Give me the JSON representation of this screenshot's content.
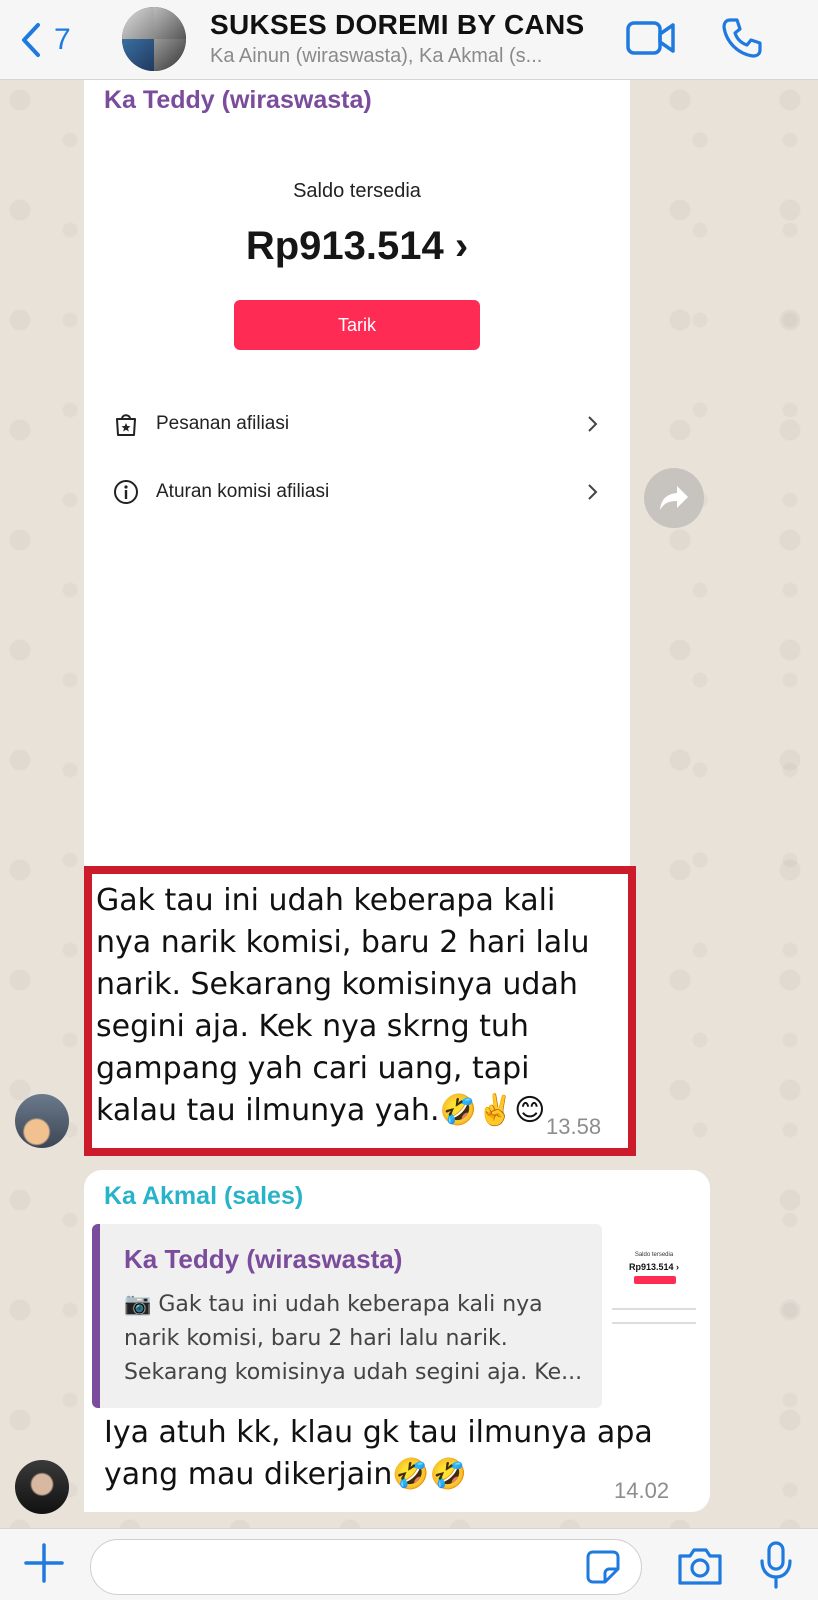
{
  "header": {
    "back_count": "7",
    "title": "SUKSES DOREMI BY CANS",
    "subtitle": "Ka Ainun (wiraswasta), Ka Akmal (s..."
  },
  "messages": {
    "image_msg": {
      "sender": "Ka Teddy (wiraswasta)",
      "screenshot": {
        "saldo_label": "Saldo tersedia",
        "saldo_amount": "Rp913.514 ›",
        "tarik_label": "Tarik",
        "menu": [
          {
            "label": "Pesanan afiliasi",
            "icon": "shopping-bag-icon"
          },
          {
            "label": "Aturan komisi afiliasi",
            "icon": "info-icon"
          }
        ]
      },
      "caption": "Gak tau ini udah keberapa kali nya narik komisi, baru 2 hari lalu narik. Sekarang komisinya udah segini aja. Kek nya skrng tuh gampang yah cari uang, tapi kalau tau ilmunya yah.🤣✌️😊",
      "time": "13.58"
    },
    "reply_msg": {
      "sender": "Ka Akmal (sales)",
      "quote_sender": "Ka Teddy (wiraswasta)",
      "quote_text": "📷 Gak tau ini udah keberapa kali nya narik komisi, baru 2 hari lalu narik. Sekarang komisinya udah segini aja. Ke...",
      "text": "Iya atuh kk, klau gk tau ilmunya apa yang mau dikerjain🤣🤣",
      "time": "14.02"
    }
  },
  "thumb": {
    "saldo_label": "Saldo tersedia",
    "saldo_amount": "Rp913.514 ›"
  },
  "colors": {
    "accent_blue": "#1f7ae0",
    "teddy_name": "#7b4b9c",
    "akmal_name": "#28b3c8",
    "tarik_red": "#fe2c55",
    "highlight_red": "#cc1c2c"
  },
  "input": {
    "placeholder": ""
  }
}
